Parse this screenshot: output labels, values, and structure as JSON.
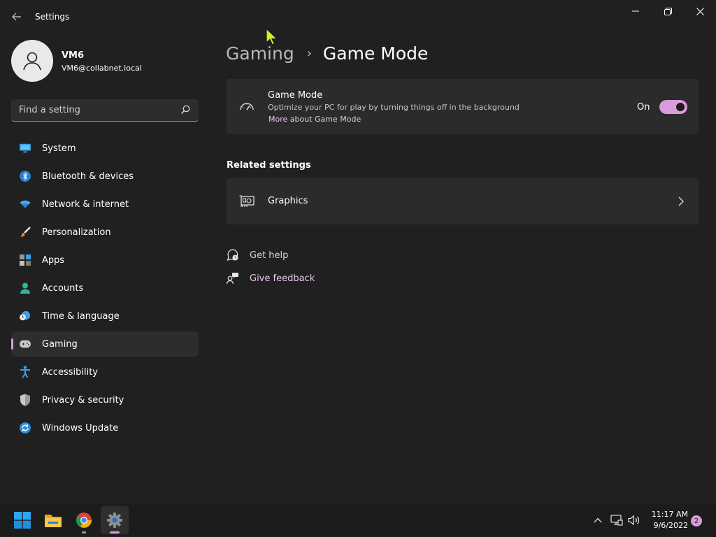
{
  "window": {
    "title": "Settings"
  },
  "profile": {
    "name": "VM6",
    "email": "VM6@collabnet.local"
  },
  "search": {
    "placeholder": "Find a setting"
  },
  "sidebar": {
    "items": [
      {
        "label": "System",
        "icon": "monitor-icon",
        "active": false
      },
      {
        "label": "Bluetooth & devices",
        "icon": "bluetooth-icon",
        "active": false
      },
      {
        "label": "Network & internet",
        "icon": "wifi-icon",
        "active": false
      },
      {
        "label": "Personalization",
        "icon": "brush-icon",
        "active": false
      },
      {
        "label": "Apps",
        "icon": "apps-icon",
        "active": false
      },
      {
        "label": "Accounts",
        "icon": "person-icon",
        "active": false
      },
      {
        "label": "Time & language",
        "icon": "clock-globe-icon",
        "active": false
      },
      {
        "label": "Gaming",
        "icon": "gamepad-icon",
        "active": true
      },
      {
        "label": "Accessibility",
        "icon": "accessibility-icon",
        "active": false
      },
      {
        "label": "Privacy & security",
        "icon": "shield-icon",
        "active": false
      },
      {
        "label": "Windows Update",
        "icon": "update-icon",
        "active": false
      }
    ]
  },
  "breadcrumb": {
    "parent": "Gaming",
    "separator": "›",
    "current": "Game Mode"
  },
  "game_mode": {
    "title": "Game Mode",
    "description": "Optimize your PC for play by turning things off in the background",
    "link": "More about Game Mode",
    "toggle_state": "On",
    "toggle_on": true
  },
  "related": {
    "heading": "Related settings",
    "graphics_label": "Graphics"
  },
  "help": {
    "get_help": "Get help",
    "give_feedback": "Give feedback"
  },
  "taskbar": {
    "time": "11:17 AM",
    "date": "9/6/2022",
    "notifications": "2"
  },
  "colors": {
    "accent": "#d89bdc",
    "background": "#202020",
    "card": "#2b2b2b"
  }
}
